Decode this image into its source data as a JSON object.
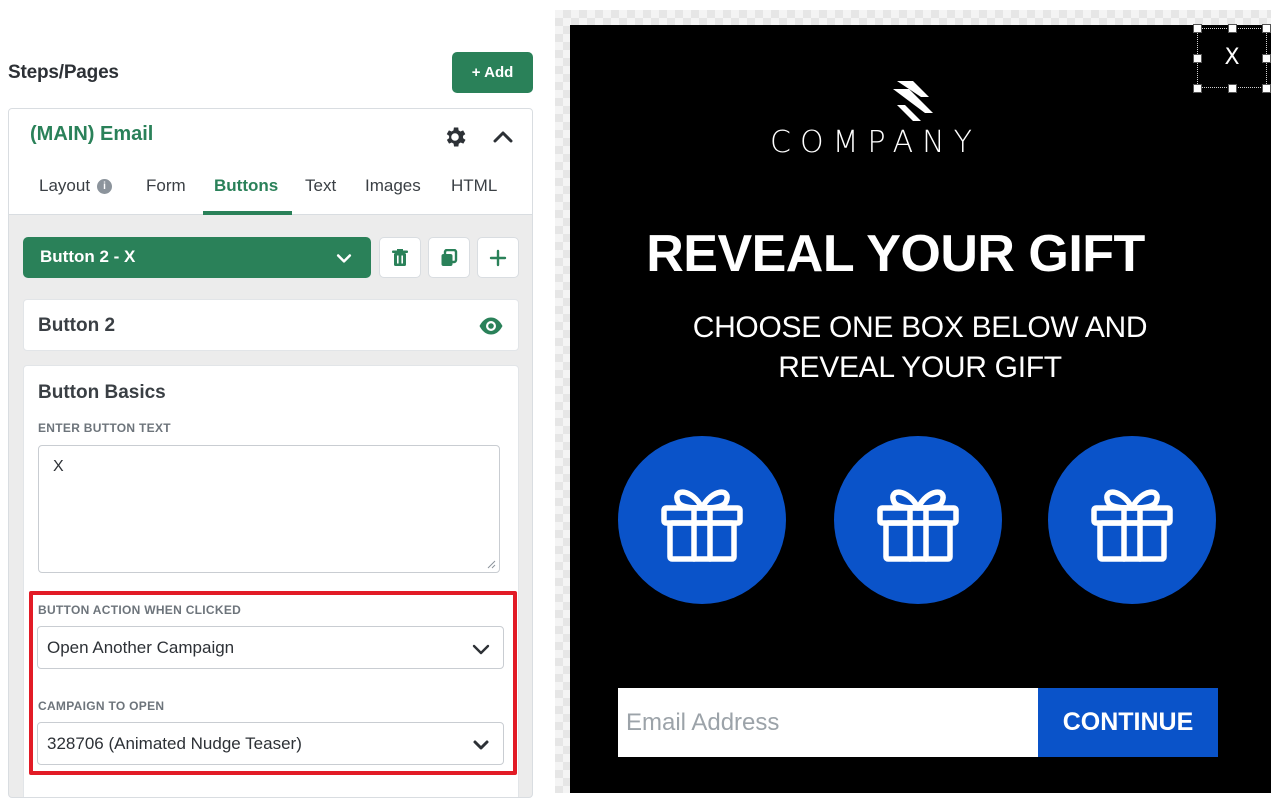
{
  "sidebar": {
    "title": "Steps/Pages",
    "add_label": "+ Add",
    "step": {
      "title": "(MAIN) Email",
      "tabs": [
        {
          "label": "Layout"
        },
        {
          "label": "Form"
        },
        {
          "label": "Buttons",
          "active": true
        },
        {
          "label": "Text"
        },
        {
          "label": "Images"
        },
        {
          "label": "HTML"
        }
      ],
      "info_glyph": "i"
    },
    "button_selector": {
      "value": "Button 2 - X"
    },
    "button_name": "Button 2",
    "basics": {
      "title": "Button Basics",
      "text_label": "ENTER BUTTON TEXT",
      "text_value": "X",
      "action_label": "BUTTON ACTION WHEN CLICKED",
      "action_value": "Open Another Campaign",
      "campaign_label": "CAMPAIGN TO OPEN",
      "campaign_value": "328706 (Animated Nudge Teaser)"
    }
  },
  "preview": {
    "close_label": "X",
    "company": "COMPANY",
    "headline": "REVEAL YOUR GIFT",
    "subhead_line1": "CHOOSE ONE BOX BELOW AND",
    "subhead_line2": "REVEAL YOUR GIFT",
    "email_placeholder": "Email Address",
    "continue_label": "CONTINUE",
    "gift_count": 3
  },
  "colors": {
    "brand_green": "#2a8159",
    "popup_blue": "#0a53c9",
    "highlight_red": "#e21b26",
    "popup_bg": "#000000"
  },
  "icons": [
    "gear-icon",
    "chevron-up-icon",
    "chevron-down-icon",
    "trash-icon",
    "copy-icon",
    "plus-icon",
    "eye-icon",
    "gift-icon",
    "company-logo-icon"
  ]
}
